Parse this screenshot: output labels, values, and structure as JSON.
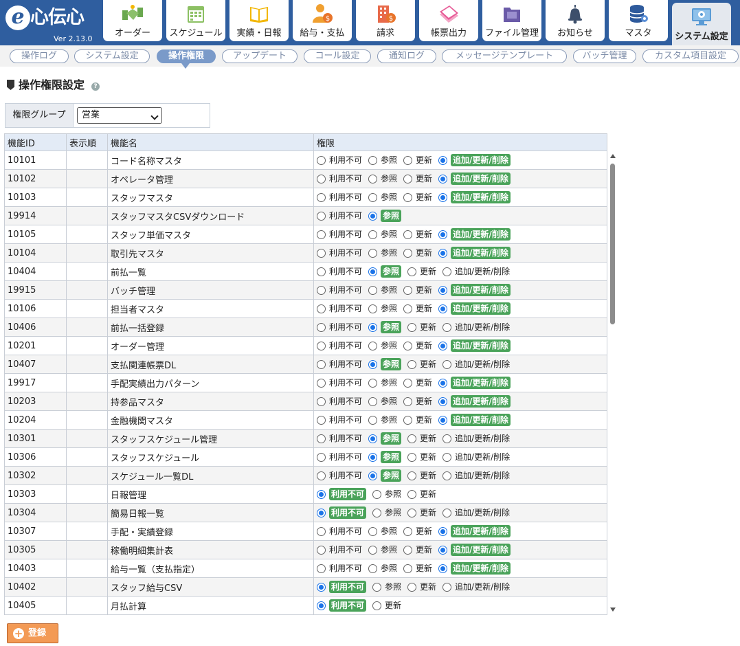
{
  "app": {
    "logo_letter": "e",
    "logo_text": "心伝心",
    "version": "Ver 2.13.0"
  },
  "nav": [
    {
      "label": "オーダー",
      "icon": "handshake-icon"
    },
    {
      "label": "スケジュール",
      "icon": "calendar-icon"
    },
    {
      "label": "実績・日報",
      "icon": "book-icon"
    },
    {
      "label": "給与・支払",
      "icon": "person-coin-icon"
    },
    {
      "label": "請求",
      "icon": "building-coin-icon"
    },
    {
      "label": "帳票出力",
      "icon": "papers-icon"
    },
    {
      "label": "ファイル管理",
      "icon": "folder-icon"
    },
    {
      "label": "お知らせ",
      "icon": "bell-icon"
    },
    {
      "label": "マスタ",
      "icon": "database-icon"
    },
    {
      "label": "システム設定",
      "icon": "monitor-gear-icon"
    }
  ],
  "subnav": [
    "操作ログ",
    "システム設定",
    "操作権限",
    "アップデート",
    "コール設定",
    "通知ログ",
    "メッセージテンプレート",
    "バッチ管理",
    "カスタム項目設定"
  ],
  "page": {
    "title": "操作権限設定",
    "help": "?"
  },
  "group": {
    "label": "権限グループ",
    "selected": "営業"
  },
  "table": {
    "headers": [
      "機能ID",
      "表示順",
      "機能名",
      "権限"
    ],
    "rows": [
      {
        "id": "10101",
        "order": "",
        "name": "コード名称マスタ",
        "options": [
          "利用不可",
          "参照",
          "更新",
          "追加/更新/削除"
        ],
        "selected": 3
      },
      {
        "id": "10102",
        "order": "",
        "name": "オペレータ管理",
        "options": [
          "利用不可",
          "参照",
          "更新",
          "追加/更新/削除"
        ],
        "selected": 3
      },
      {
        "id": "10103",
        "order": "",
        "name": "スタッフマスタ",
        "options": [
          "利用不可",
          "参照",
          "更新",
          "追加/更新/削除"
        ],
        "selected": 3
      },
      {
        "id": "19914",
        "order": "",
        "name": "スタッフマスタCSVダウンロード",
        "options": [
          "利用不可",
          "参照"
        ],
        "selected": 1
      },
      {
        "id": "10105",
        "order": "",
        "name": "スタッフ単価マスタ",
        "options": [
          "利用不可",
          "参照",
          "更新",
          "追加/更新/削除"
        ],
        "selected": 3
      },
      {
        "id": "10104",
        "order": "",
        "name": "取引先マスタ",
        "options": [
          "利用不可",
          "参照",
          "更新",
          "追加/更新/削除"
        ],
        "selected": 3
      },
      {
        "id": "10404",
        "order": "",
        "name": "前払一覧",
        "options": [
          "利用不可",
          "参照",
          "更新",
          "追加/更新/削除"
        ],
        "selected": 1
      },
      {
        "id": "19915",
        "order": "",
        "name": "バッチ管理",
        "options": [
          "利用不可",
          "参照",
          "更新",
          "追加/更新/削除"
        ],
        "selected": 3
      },
      {
        "id": "10106",
        "order": "",
        "name": "担当者マスタ",
        "options": [
          "利用不可",
          "参照",
          "更新",
          "追加/更新/削除"
        ],
        "selected": 3
      },
      {
        "id": "10406",
        "order": "",
        "name": "前払一括登録",
        "options": [
          "利用不可",
          "参照",
          "更新",
          "追加/更新/削除"
        ],
        "selected": 1
      },
      {
        "id": "10201",
        "order": "",
        "name": "オーダー管理",
        "options": [
          "利用不可",
          "参照",
          "更新",
          "追加/更新/削除"
        ],
        "selected": 3
      },
      {
        "id": "10407",
        "order": "",
        "name": "支払関連帳票DL",
        "options": [
          "利用不可",
          "参照",
          "更新",
          "追加/更新/削除"
        ],
        "selected": 1
      },
      {
        "id": "19917",
        "order": "",
        "name": "手配実績出力パターン",
        "options": [
          "利用不可",
          "参照",
          "更新",
          "追加/更新/削除"
        ],
        "selected": 3
      },
      {
        "id": "10203",
        "order": "",
        "name": "持参品マスタ",
        "options": [
          "利用不可",
          "参照",
          "更新",
          "追加/更新/削除"
        ],
        "selected": 3
      },
      {
        "id": "10204",
        "order": "",
        "name": "金融機関マスタ",
        "options": [
          "利用不可",
          "参照",
          "更新",
          "追加/更新/削除"
        ],
        "selected": 3
      },
      {
        "id": "10301",
        "order": "",
        "name": "スタッフスケジュール管理",
        "options": [
          "利用不可",
          "参照",
          "更新",
          "追加/更新/削除"
        ],
        "selected": 1
      },
      {
        "id": "10306",
        "order": "",
        "name": "スタッフスケジュール",
        "options": [
          "利用不可",
          "参照",
          "更新",
          "追加/更新/削除"
        ],
        "selected": 1
      },
      {
        "id": "10302",
        "order": "",
        "name": "スケジュール一覧DL",
        "options": [
          "利用不可",
          "参照",
          "更新",
          "追加/更新/削除"
        ],
        "selected": 1
      },
      {
        "id": "10303",
        "order": "",
        "name": "日報管理",
        "options": [
          "利用不可",
          "参照",
          "更新"
        ],
        "selected": 0
      },
      {
        "id": "10304",
        "order": "",
        "name": "簡易日報一覧",
        "options": [
          "利用不可",
          "参照",
          "更新",
          "追加/更新/削除"
        ],
        "selected": 0
      },
      {
        "id": "10307",
        "order": "",
        "name": "手配・実績登録",
        "options": [
          "利用不可",
          "参照",
          "更新",
          "追加/更新/削除"
        ],
        "selected": 3
      },
      {
        "id": "10305",
        "order": "",
        "name": "稼働明細集計表",
        "options": [
          "利用不可",
          "参照",
          "更新",
          "追加/更新/削除"
        ],
        "selected": 3
      },
      {
        "id": "10403",
        "order": "",
        "name": "給与一覧（支払指定）",
        "options": [
          "利用不可",
          "参照",
          "更新",
          "追加/更新/削除"
        ],
        "selected": 3
      },
      {
        "id": "10402",
        "order": "",
        "name": "スタッフ給与CSV",
        "options": [
          "利用不可",
          "参照",
          "更新",
          "追加/更新/削除"
        ],
        "selected": 0
      },
      {
        "id": "10405",
        "order": "",
        "name": "月払計算",
        "options": [
          "利用不可",
          "更新"
        ],
        "selected": 0
      }
    ]
  },
  "buttons": {
    "register": "登録",
    "register_icon": "plus-circle-icon"
  },
  "colors": {
    "header_blue": "#2f5e9f",
    "selected_green": "#4aa35a",
    "radio_blue": "#1a73e8",
    "button_orange": "#f39a55"
  }
}
